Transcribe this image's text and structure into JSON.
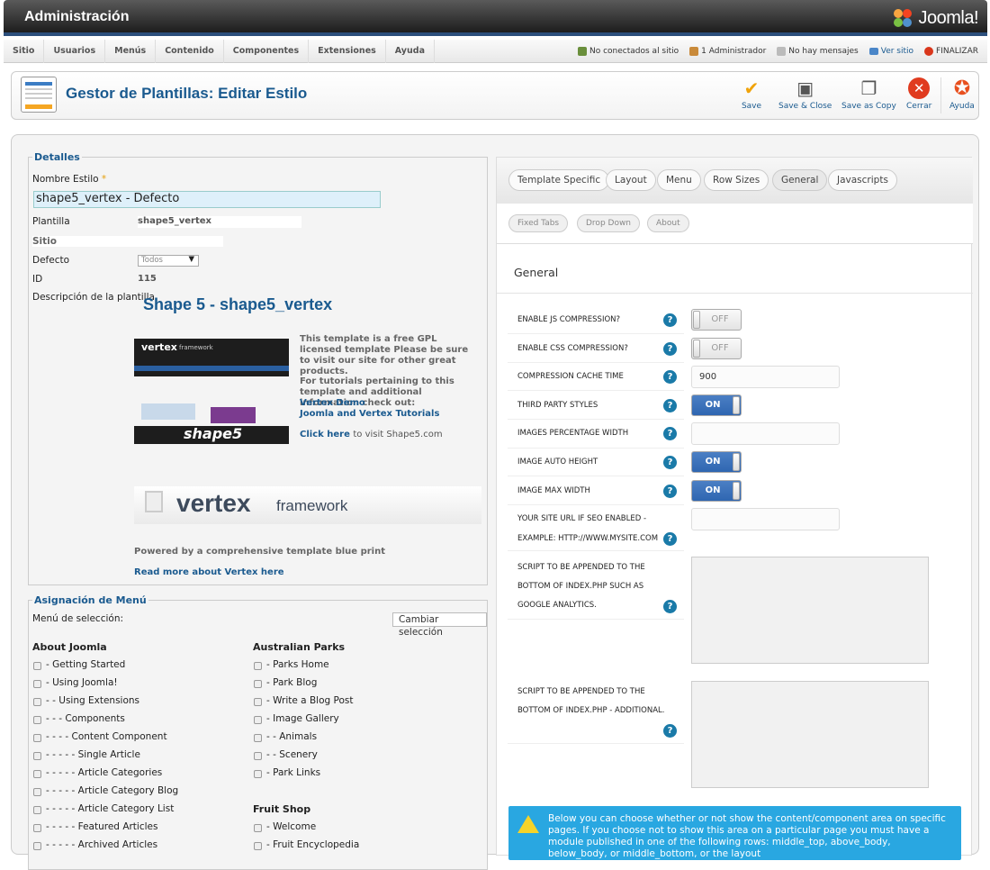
{
  "header": {
    "title": "Administración",
    "logo": "Joomla!"
  },
  "menu": [
    "Sitio",
    "Usuarios",
    "Menús",
    "Contenido",
    "Componentes",
    "Extensiones",
    "Ayuda"
  ],
  "status": {
    "visitors": "No conectados al sitio",
    "admins": "1 Administrador",
    "messages": "No hay mensajes",
    "view_site": "Ver sitio",
    "logout": "FINALIZAR"
  },
  "toolbar": {
    "page_title": "Gestor de Plantillas: Editar Estilo",
    "save": "Save",
    "save_close": "Save & Close",
    "save_copy": "Save as Copy",
    "close": "Cerrar",
    "help": "Ayuda"
  },
  "details": {
    "legend": "Detalles",
    "name_label": "Nombre Estilo",
    "required_mark": "*",
    "name_value": "shape5_vertex - Defecto",
    "template_label": "Plantilla",
    "template_value": "shape5_vertex",
    "site_label": "Sitio",
    "default_label": "Defecto",
    "default_value": "Todos",
    "id_label": "ID",
    "id_value": "115",
    "desc_label": "Descripción de la plantilla",
    "desc_title": "Shape 5 - shape5_vertex",
    "blurb1": "This template is a free GPL licensed template Please be sure to visit our site for other great products.",
    "blurb2": "For tutorials pertaining to this template and additional information check out:",
    "link1": "Vertex Demo",
    "link2": "Joomla and Vertex Tutorials",
    "click_here": "Click here",
    "click_rest": "to visit Shape5.com",
    "shot_title": "vertex",
    "shot_sub": "framework",
    "shot_logo": "shape5",
    "banner_word": "vertex",
    "banner_sub": "framework",
    "powered": "Powered by a comprehensive template blue print",
    "read_more": "Read more about Vertex here"
  },
  "menu_assign": {
    "legend": "Asignación de Menú",
    "select_label": "Menú de selección:",
    "change_btn": "Cambiar selección",
    "col1_head": "About Joomla",
    "col1": [
      "- Getting Started",
      "- Using Joomla!",
      "- - Using Extensions",
      "- - - Components",
      "- - - - Content Component",
      "- - - - - Single Article",
      "- - - - - Article Categories",
      "- - - - - Article Category Blog",
      "- - - - - Article Category List",
      "- - - - - Featured Articles",
      "- - - - - Archived Articles"
    ],
    "col2_head": "Australian Parks",
    "col2": [
      "- Parks Home",
      "- Park Blog",
      "- Write a Blog Post",
      "- Image Gallery",
      "- - Animals",
      "- - Scenery",
      "- Park Links"
    ],
    "col3_head": "Fruit Shop",
    "col3": [
      "- Welcome",
      "- Fruit Encyclopedia"
    ]
  },
  "tabs": {
    "row1": [
      "Template Specific",
      "Layout",
      "Menu",
      "Row Sizes",
      "General",
      "Javascripts"
    ],
    "row2": [
      "Fixed Tabs",
      "Drop Down",
      "About"
    ],
    "section": "General"
  },
  "settings": {
    "js": "ENABLE JS COMPRESSION?",
    "css": "ENABLE CSS COMPRESSION?",
    "cache": "COMPRESSION CACHE TIME",
    "cache_val": "900",
    "third": "THIRD PARTY STYLES",
    "imgpct": "IMAGES PERCENTAGE WIDTH",
    "imgauto": "IMAGE AUTO HEIGHT",
    "imgmax": "IMAGE MAX WIDTH",
    "seo1": "YOUR SITE URL IF SEO ENABLED -",
    "seo2": "EXAMPLE: HTTP://WWW.MYSITE.COM",
    "s1a": "SCRIPT TO BE APPENDED TO THE",
    "s1b": "BOTTOM OF INDEX.PHP SUCH AS",
    "s1c": "GOOGLE ANALYTICS.",
    "s2a": "SCRIPT TO BE APPENDED TO THE",
    "s2b": "BOTTOM OF INDEX.PHP - ADDITIONAL.",
    "off": "OFF",
    "on": "ON",
    "help": "?"
  },
  "info": "Below you can choose whether or not show the content/component area on specific pages. If you choose not to show this area on a particular page you must have a module published in one of the following rows: middle_top, above_body, below_body, or middle_bottom, or the layout"
}
